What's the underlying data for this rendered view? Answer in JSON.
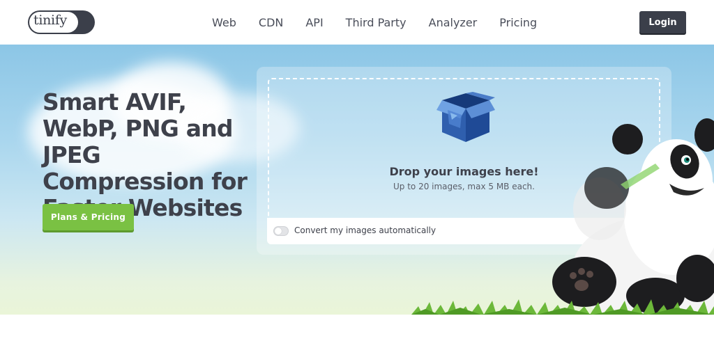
{
  "header": {
    "logo_text": "tinify",
    "nav": [
      "Web",
      "CDN",
      "API",
      "Third Party",
      "Analyzer",
      "Pricing"
    ],
    "login_label": "Login"
  },
  "hero": {
    "headline": "Smart AVIF, WebP, PNG and JPEG Compression for Faster Websites",
    "plans_label": "Plans & Pricing"
  },
  "dropzone": {
    "icon": "open-box-icon",
    "title": "Drop your images here!",
    "subtitle": "Up to 20 images, max 5 MB each.",
    "convert_label": "Convert my images automatically",
    "convert_enabled": false
  },
  "colors": {
    "dark": "#3b3f4a",
    "green": "#7ac143",
    "sky": "#8cc6e6"
  }
}
